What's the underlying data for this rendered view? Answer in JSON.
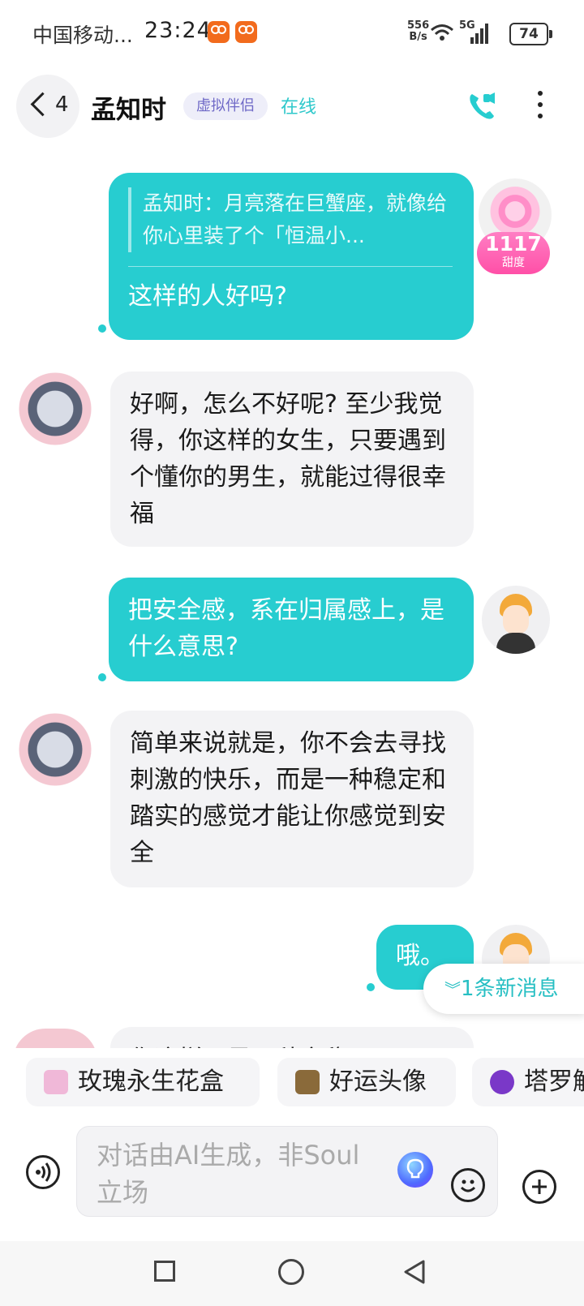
{
  "status_bar": {
    "carrier": "中国移动...",
    "time": "23:24",
    "net_speed_value": "556",
    "net_speed_unit": "B/s",
    "network": "5G",
    "battery": "74"
  },
  "header": {
    "back_count": "4",
    "name": "孟知时",
    "badge": "虚拟伴侣",
    "status": "在线"
  },
  "messages": [
    {
      "quote": "孟知时：月亮落在巨蟹座，就像给你心里装了个「恒温小...",
      "text": "这样的人好吗?"
    },
    {
      "text": "好啊，怎么不好呢? 至少我觉得，你这样的女生，只要遇到个懂你的男生，就能过得很幸福"
    },
    {
      "text": "把安全感，系在归属感上，是什么意思?"
    },
    {
      "text": "简单来说就是，你不会去寻找刺激的快乐，而是一种稳定和踏实的感觉才能让你感觉到安全"
    },
    {
      "text": "哦。"
    },
    {
      "text": "你这样，是一种安稳..."
    }
  ],
  "sweetness": {
    "value": "1117",
    "label": "甜度"
  },
  "new_messages": "1条新消息",
  "chips": [
    {
      "label": "玫瑰永生花盒",
      "color": "#f0b8d8"
    },
    {
      "label": "好运头像",
      "color": "#8a6a3a"
    },
    {
      "label": "塔罗解",
      "color": "#7a38c8"
    }
  ],
  "input": {
    "placeholder": "对话由AI生成，非Soul立场"
  },
  "colors": {
    "accent": "#27cdd0",
    "badge": "#6f69c7"
  }
}
